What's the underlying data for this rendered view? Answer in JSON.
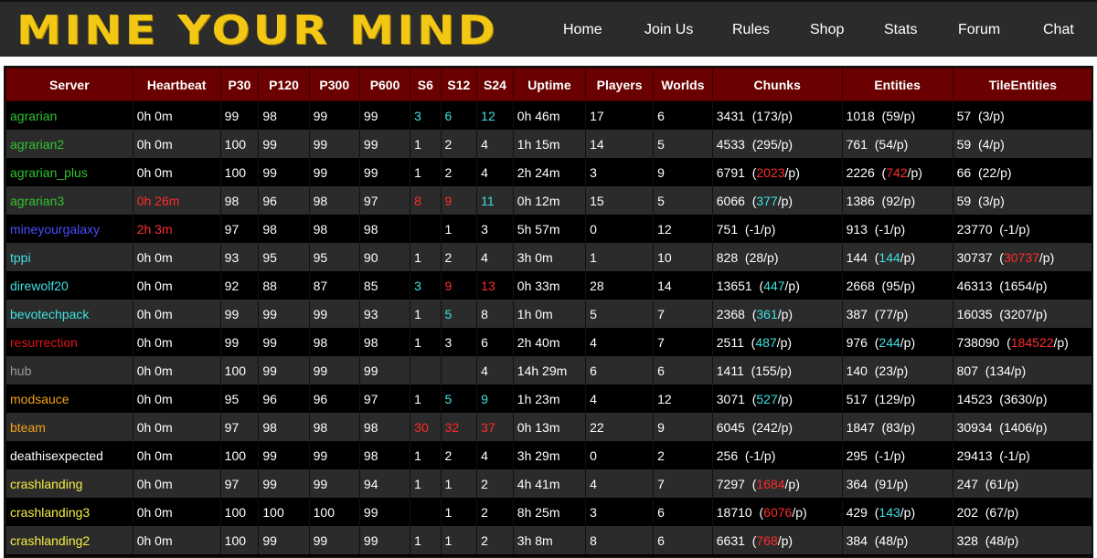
{
  "header": {
    "logo": "MINE YOUR MIND",
    "nav": [
      "Home",
      "Join Us",
      "Rules",
      "Shop",
      "Stats",
      "Forum",
      "Chat"
    ]
  },
  "colors": {
    "green": "#2fc42f",
    "blue": "#4c4cff",
    "cyan": "#3fe0e0",
    "red": "#ff2b2b",
    "orange": "#f2a01a",
    "gray": "#9a9a9a",
    "yellow": "#f6ee43",
    "header_bg": "#6b0000"
  },
  "table": {
    "columns": [
      "Server",
      "Heartbeat",
      "P30",
      "P120",
      "P300",
      "P600",
      "S6",
      "S12",
      "S24",
      "Uptime",
      "Players",
      "Worlds",
      "Chunks",
      "Entities",
      "TileEntities"
    ],
    "rows": [
      {
        "server": "agrarian",
        "server_color": "green",
        "heartbeat": "0h 0m",
        "hb_color": "",
        "p30": "99",
        "p120": "98",
        "p300": "99",
        "p600": "99",
        "s6": "3",
        "s6c": "cyan",
        "s12": "6",
        "s12c": "cyan",
        "s24": "12",
        "s24c": "cyan",
        "uptime": "0h 46m",
        "players": "17",
        "worlds": "6",
        "chunks": "3431",
        "chunks_pp": "173",
        "chunks_c": "",
        "entities": "1018",
        "entities_pp": "59",
        "entities_c": "",
        "tiles": "57",
        "tiles_pp": "3",
        "tiles_c": ""
      },
      {
        "server": "agrarian2",
        "server_color": "green",
        "heartbeat": "0h 0m",
        "hb_color": "",
        "p30": "100",
        "p120": "99",
        "p300": "99",
        "p600": "99",
        "s6": "1",
        "s6c": "",
        "s12": "2",
        "s12c": "",
        "s24": "4",
        "s24c": "",
        "uptime": "1h 15m",
        "players": "14",
        "worlds": "5",
        "chunks": "4533",
        "chunks_pp": "295",
        "chunks_c": "",
        "entities": "761",
        "entities_pp": "54",
        "entities_c": "",
        "tiles": "59",
        "tiles_pp": "4",
        "tiles_c": ""
      },
      {
        "server": "agrarian_plus",
        "server_color": "green",
        "heartbeat": "0h 0m",
        "hb_color": "",
        "p30": "100",
        "p120": "99",
        "p300": "99",
        "p600": "99",
        "s6": "1",
        "s6c": "",
        "s12": "2",
        "s12c": "",
        "s24": "4",
        "s24c": "",
        "uptime": "2h 24m",
        "players": "3",
        "worlds": "9",
        "chunks": "6791",
        "chunks_pp": "2023",
        "chunks_c": "red",
        "entities": "2226",
        "entities_pp": "742",
        "entities_c": "red",
        "tiles": "66",
        "tiles_pp": "22",
        "tiles_c": ""
      },
      {
        "server": "agrarian3",
        "server_color": "green",
        "heartbeat": "0h 26m",
        "hb_color": "red",
        "p30": "98",
        "p120": "96",
        "p300": "98",
        "p600": "97",
        "s6": "8",
        "s6c": "red",
        "s12": "9",
        "s12c": "red",
        "s24": "11",
        "s24c": "cyan",
        "uptime": "0h 12m",
        "players": "15",
        "worlds": "5",
        "chunks": "6066",
        "chunks_pp": "377",
        "chunks_c": "cyan",
        "entities": "1386",
        "entities_pp": "92",
        "entities_c": "",
        "tiles": "59",
        "tiles_pp": "3",
        "tiles_c": ""
      },
      {
        "server": "mineyourgalaxy",
        "server_color": "blue",
        "heartbeat": "2h 3m",
        "hb_color": "red",
        "p30": "97",
        "p120": "98",
        "p300": "98",
        "p600": "98",
        "s6": "",
        "s6c": "",
        "s12": "1",
        "s12c": "",
        "s24": "3",
        "s24c": "",
        "uptime": "5h 57m",
        "players": "0",
        "worlds": "12",
        "chunks": "751",
        "chunks_pp": "-1",
        "chunks_c": "",
        "entities": "913",
        "entities_pp": "-1",
        "entities_c": "",
        "tiles": "23770",
        "tiles_pp": "-1",
        "tiles_c": ""
      },
      {
        "server": "tppi",
        "server_color": "cyan",
        "heartbeat": "0h 0m",
        "hb_color": "",
        "p30": "93",
        "p120": "95",
        "p300": "95",
        "p600": "90",
        "s6": "1",
        "s6c": "",
        "s12": "2",
        "s12c": "",
        "s24": "4",
        "s24c": "",
        "uptime": "3h 0m",
        "players": "1",
        "worlds": "10",
        "chunks": "828",
        "chunks_pp": "28",
        "chunks_c": "",
        "entities": "144",
        "entities_pp": "144",
        "entities_c": "cyan",
        "tiles": "30737",
        "tiles_pp": "30737",
        "tiles_c": "red"
      },
      {
        "server": "direwolf20",
        "server_color": "cyan",
        "heartbeat": "0h 0m",
        "hb_color": "",
        "p30": "92",
        "p120": "88",
        "p300": "87",
        "p600": "85",
        "s6": "3",
        "s6c": "cyan",
        "s12": "9",
        "s12c": "red",
        "s24": "13",
        "s24c": "red",
        "uptime": "0h 33m",
        "players": "28",
        "worlds": "14",
        "chunks": "13651",
        "chunks_pp": "447",
        "chunks_c": "cyan",
        "entities": "2668",
        "entities_pp": "95",
        "entities_c": "",
        "tiles": "46313",
        "tiles_pp": "1654",
        "tiles_c": ""
      },
      {
        "server": "bevotechpack",
        "server_color": "cyan",
        "heartbeat": "0h 0m",
        "hb_color": "",
        "p30": "99",
        "p120": "99",
        "p300": "99",
        "p600": "93",
        "s6": "1",
        "s6c": "",
        "s12": "5",
        "s12c": "cyan",
        "s24": "8",
        "s24c": "",
        "uptime": "1h 0m",
        "players": "5",
        "worlds": "7",
        "chunks": "2368",
        "chunks_pp": "361",
        "chunks_c": "cyan",
        "entities": "387",
        "entities_pp": "77",
        "entities_c": "",
        "tiles": "16035",
        "tiles_pp": "3207",
        "tiles_c": ""
      },
      {
        "server": "resurrection",
        "server_color": "darkred",
        "heartbeat": "0h 0m",
        "hb_color": "",
        "p30": "99",
        "p120": "99",
        "p300": "98",
        "p600": "98",
        "s6": "1",
        "s6c": "",
        "s12": "3",
        "s12c": "",
        "s24": "6",
        "s24c": "",
        "uptime": "2h 40m",
        "players": "4",
        "worlds": "7",
        "chunks": "2511",
        "chunks_pp": "487",
        "chunks_c": "cyan",
        "entities": "976",
        "entities_pp": "244",
        "entities_c": "cyan",
        "tiles": "738090",
        "tiles_pp": "184522",
        "tiles_c": "red"
      },
      {
        "server": "hub",
        "server_color": "gray",
        "heartbeat": "0h 0m",
        "hb_color": "",
        "p30": "100",
        "p120": "99",
        "p300": "99",
        "p600": "99",
        "s6": "",
        "s6c": "",
        "s12": "",
        "s12c": "",
        "s24": "4",
        "s24c": "",
        "uptime": "14h 29m",
        "players": "6",
        "worlds": "6",
        "chunks": "1411",
        "chunks_pp": "155",
        "chunks_c": "",
        "entities": "140",
        "entities_pp": "23",
        "entities_c": "",
        "tiles": "807",
        "tiles_pp": "134",
        "tiles_c": ""
      },
      {
        "server": "modsauce",
        "server_color": "orange",
        "heartbeat": "0h 0m",
        "hb_color": "",
        "p30": "95",
        "p120": "96",
        "p300": "96",
        "p600": "97",
        "s6": "1",
        "s6c": "",
        "s12": "5",
        "s12c": "cyan",
        "s24": "9",
        "s24c": "cyan",
        "uptime": "1h 23m",
        "players": "4",
        "worlds": "12",
        "chunks": "3071",
        "chunks_pp": "527",
        "chunks_c": "cyan",
        "entities": "517",
        "entities_pp": "129",
        "entities_c": "",
        "tiles": "14523",
        "tiles_pp": "3630",
        "tiles_c": ""
      },
      {
        "server": "bteam",
        "server_color": "orange",
        "heartbeat": "0h 0m",
        "hb_color": "",
        "p30": "97",
        "p120": "98",
        "p300": "98",
        "p600": "98",
        "s6": "30",
        "s6c": "red",
        "s12": "32",
        "s12c": "red",
        "s24": "37",
        "s24c": "red",
        "uptime": "0h 13m",
        "players": "22",
        "worlds": "9",
        "chunks": "6045",
        "chunks_pp": "242",
        "chunks_c": "",
        "entities": "1847",
        "entities_pp": "83",
        "entities_c": "",
        "tiles": "30934",
        "tiles_pp": "1406",
        "tiles_c": ""
      },
      {
        "server": "deathisexpected",
        "server_color": "white",
        "heartbeat": "0h 0m",
        "hb_color": "",
        "p30": "100",
        "p120": "99",
        "p300": "99",
        "p600": "98",
        "s6": "1",
        "s6c": "",
        "s12": "2",
        "s12c": "",
        "s24": "4",
        "s24c": "",
        "uptime": "3h 29m",
        "players": "0",
        "worlds": "2",
        "chunks": "256",
        "chunks_pp": "-1",
        "chunks_c": "",
        "entities": "295",
        "entities_pp": "-1",
        "entities_c": "",
        "tiles": "29413",
        "tiles_pp": "-1",
        "tiles_c": ""
      },
      {
        "server": "crashlanding",
        "server_color": "yellow",
        "heartbeat": "0h 0m",
        "hb_color": "",
        "p30": "97",
        "p120": "99",
        "p300": "99",
        "p600": "94",
        "s6": "1",
        "s6c": "",
        "s12": "1",
        "s12c": "",
        "s24": "2",
        "s24c": "",
        "uptime": "4h 41m",
        "players": "4",
        "worlds": "7",
        "chunks": "7297",
        "chunks_pp": "1684",
        "chunks_c": "red",
        "entities": "364",
        "entities_pp": "91",
        "entities_c": "",
        "tiles": "247",
        "tiles_pp": "61",
        "tiles_c": ""
      },
      {
        "server": "crashlanding3",
        "server_color": "yellow",
        "heartbeat": "0h 0m",
        "hb_color": "",
        "p30": "100",
        "p120": "100",
        "p300": "100",
        "p600": "99",
        "s6": "",
        "s6c": "",
        "s12": "1",
        "s12c": "",
        "s24": "2",
        "s24c": "",
        "uptime": "8h 25m",
        "players": "3",
        "worlds": "6",
        "chunks": "18710",
        "chunks_pp": "6076",
        "chunks_c": "red",
        "entities": "429",
        "entities_pp": "143",
        "entities_c": "cyan",
        "tiles": "202",
        "tiles_pp": "67",
        "tiles_c": ""
      },
      {
        "server": "crashlanding2",
        "server_color": "yellow",
        "heartbeat": "0h 0m",
        "hb_color": "",
        "p30": "100",
        "p120": "99",
        "p300": "99",
        "p600": "99",
        "s6": "1",
        "s6c": "",
        "s12": "1",
        "s12c": "",
        "s24": "2",
        "s24c": "",
        "uptime": "3h 8m",
        "players": "8",
        "worlds": "6",
        "chunks": "6631",
        "chunks_pp": "768",
        "chunks_c": "red",
        "entities": "384",
        "entities_pp": "48",
        "entities_c": "",
        "tiles": "328",
        "tiles_pp": "48",
        "tiles_c": ""
      }
    ]
  }
}
